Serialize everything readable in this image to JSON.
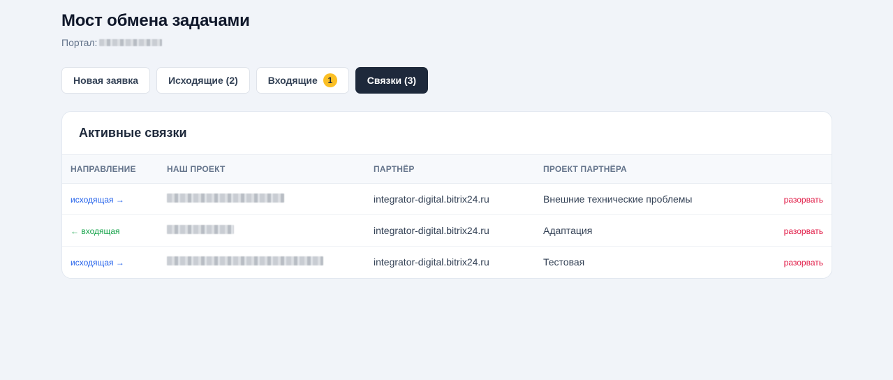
{
  "header": {
    "title": "Мост обмена задачами",
    "portal_label": "Портал:"
  },
  "tabs": [
    {
      "label": "Новая заявка",
      "active": false
    },
    {
      "label": "Исходящие (2)",
      "active": false
    },
    {
      "label": "Входящие",
      "badge": "1",
      "active": false
    },
    {
      "label": "Связки (3)",
      "active": true
    }
  ],
  "card": {
    "title": "Активные связки",
    "columns": [
      "Направление",
      "Наш проект",
      "Партнёр",
      "Проект партнёра",
      ""
    ],
    "rows": [
      {
        "direction": "исходящая →",
        "direction_type": "outgoing",
        "partner": "integrator-digital.bitrix24.ru",
        "partner_project": "Внешние технические проблемы",
        "action": "разорвать"
      },
      {
        "direction": "← входящая",
        "direction_type": "incoming",
        "partner": "integrator-digital.bitrix24.ru",
        "partner_project": "Адаптация",
        "action": "разорвать"
      },
      {
        "direction": "исходящая →",
        "direction_type": "outgoing",
        "partner": "integrator-digital.bitrix24.ru",
        "partner_project": "Тестовая",
        "action": "разорвать"
      }
    ]
  },
  "colors": {
    "active_tab": "#1e293b",
    "badge": "#fbbf24",
    "outgoing": "#2563eb",
    "incoming": "#16a34a",
    "unlink": "#e11d48"
  }
}
